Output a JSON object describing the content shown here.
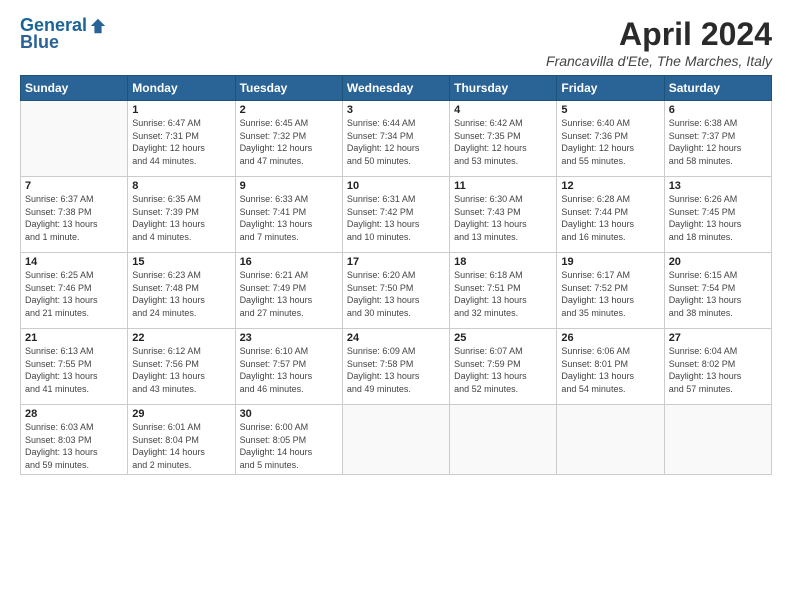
{
  "header": {
    "logo_line1": "General",
    "logo_line2": "Blue",
    "title": "April 2024",
    "subtitle": "Francavilla d'Ete, The Marches, Italy"
  },
  "days_of_week": [
    "Sunday",
    "Monday",
    "Tuesday",
    "Wednesday",
    "Thursday",
    "Friday",
    "Saturday"
  ],
  "weeks": [
    [
      {
        "day": "",
        "info": ""
      },
      {
        "day": "1",
        "info": "Sunrise: 6:47 AM\nSunset: 7:31 PM\nDaylight: 12 hours\nand 44 minutes."
      },
      {
        "day": "2",
        "info": "Sunrise: 6:45 AM\nSunset: 7:32 PM\nDaylight: 12 hours\nand 47 minutes."
      },
      {
        "day": "3",
        "info": "Sunrise: 6:44 AM\nSunset: 7:34 PM\nDaylight: 12 hours\nand 50 minutes."
      },
      {
        "day": "4",
        "info": "Sunrise: 6:42 AM\nSunset: 7:35 PM\nDaylight: 12 hours\nand 53 minutes."
      },
      {
        "day": "5",
        "info": "Sunrise: 6:40 AM\nSunset: 7:36 PM\nDaylight: 12 hours\nand 55 minutes."
      },
      {
        "day": "6",
        "info": "Sunrise: 6:38 AM\nSunset: 7:37 PM\nDaylight: 12 hours\nand 58 minutes."
      }
    ],
    [
      {
        "day": "7",
        "info": "Sunrise: 6:37 AM\nSunset: 7:38 PM\nDaylight: 13 hours\nand 1 minute."
      },
      {
        "day": "8",
        "info": "Sunrise: 6:35 AM\nSunset: 7:39 PM\nDaylight: 13 hours\nand 4 minutes."
      },
      {
        "day": "9",
        "info": "Sunrise: 6:33 AM\nSunset: 7:41 PM\nDaylight: 13 hours\nand 7 minutes."
      },
      {
        "day": "10",
        "info": "Sunrise: 6:31 AM\nSunset: 7:42 PM\nDaylight: 13 hours\nand 10 minutes."
      },
      {
        "day": "11",
        "info": "Sunrise: 6:30 AM\nSunset: 7:43 PM\nDaylight: 13 hours\nand 13 minutes."
      },
      {
        "day": "12",
        "info": "Sunrise: 6:28 AM\nSunset: 7:44 PM\nDaylight: 13 hours\nand 16 minutes."
      },
      {
        "day": "13",
        "info": "Sunrise: 6:26 AM\nSunset: 7:45 PM\nDaylight: 13 hours\nand 18 minutes."
      }
    ],
    [
      {
        "day": "14",
        "info": "Sunrise: 6:25 AM\nSunset: 7:46 PM\nDaylight: 13 hours\nand 21 minutes."
      },
      {
        "day": "15",
        "info": "Sunrise: 6:23 AM\nSunset: 7:48 PM\nDaylight: 13 hours\nand 24 minutes."
      },
      {
        "day": "16",
        "info": "Sunrise: 6:21 AM\nSunset: 7:49 PM\nDaylight: 13 hours\nand 27 minutes."
      },
      {
        "day": "17",
        "info": "Sunrise: 6:20 AM\nSunset: 7:50 PM\nDaylight: 13 hours\nand 30 minutes."
      },
      {
        "day": "18",
        "info": "Sunrise: 6:18 AM\nSunset: 7:51 PM\nDaylight: 13 hours\nand 32 minutes."
      },
      {
        "day": "19",
        "info": "Sunrise: 6:17 AM\nSunset: 7:52 PM\nDaylight: 13 hours\nand 35 minutes."
      },
      {
        "day": "20",
        "info": "Sunrise: 6:15 AM\nSunset: 7:54 PM\nDaylight: 13 hours\nand 38 minutes."
      }
    ],
    [
      {
        "day": "21",
        "info": "Sunrise: 6:13 AM\nSunset: 7:55 PM\nDaylight: 13 hours\nand 41 minutes."
      },
      {
        "day": "22",
        "info": "Sunrise: 6:12 AM\nSunset: 7:56 PM\nDaylight: 13 hours\nand 43 minutes."
      },
      {
        "day": "23",
        "info": "Sunrise: 6:10 AM\nSunset: 7:57 PM\nDaylight: 13 hours\nand 46 minutes."
      },
      {
        "day": "24",
        "info": "Sunrise: 6:09 AM\nSunset: 7:58 PM\nDaylight: 13 hours\nand 49 minutes."
      },
      {
        "day": "25",
        "info": "Sunrise: 6:07 AM\nSunset: 7:59 PM\nDaylight: 13 hours\nand 52 minutes."
      },
      {
        "day": "26",
        "info": "Sunrise: 6:06 AM\nSunset: 8:01 PM\nDaylight: 13 hours\nand 54 minutes."
      },
      {
        "day": "27",
        "info": "Sunrise: 6:04 AM\nSunset: 8:02 PM\nDaylight: 13 hours\nand 57 minutes."
      }
    ],
    [
      {
        "day": "28",
        "info": "Sunrise: 6:03 AM\nSunset: 8:03 PM\nDaylight: 13 hours\nand 59 minutes."
      },
      {
        "day": "29",
        "info": "Sunrise: 6:01 AM\nSunset: 8:04 PM\nDaylight: 14 hours\nand 2 minutes."
      },
      {
        "day": "30",
        "info": "Sunrise: 6:00 AM\nSunset: 8:05 PM\nDaylight: 14 hours\nand 5 minutes."
      },
      {
        "day": "",
        "info": ""
      },
      {
        "day": "",
        "info": ""
      },
      {
        "day": "",
        "info": ""
      },
      {
        "day": "",
        "info": ""
      }
    ]
  ]
}
